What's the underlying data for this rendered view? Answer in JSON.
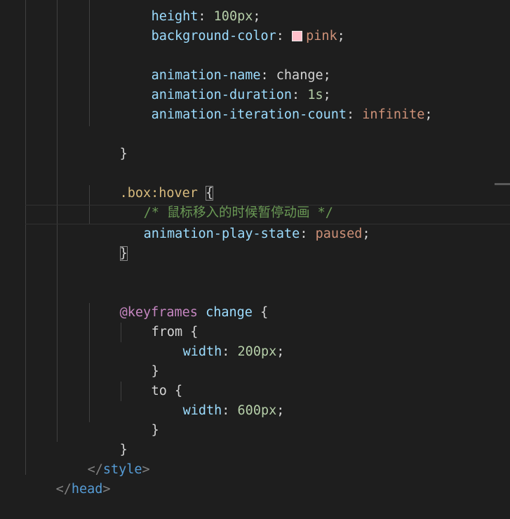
{
  "code": {
    "l0": {
      "prop": "height",
      "val": "100px"
    },
    "l1": {
      "prop": "background-color",
      "swatch": "#ffc0cb",
      "val": "pink"
    },
    "l3": {
      "prop": "animation-name",
      "val": "change"
    },
    "l4": {
      "prop": "animation-duration",
      "val": "1s"
    },
    "l5": {
      "prop": "animation-iteration-count",
      "val": "infinite"
    },
    "l7": {
      "brace": "}"
    },
    "l9": {
      "selector": ".box:hover",
      "brace": "{"
    },
    "l10": {
      "comment": "/* 鼠标移入的时候暂停动画 */"
    },
    "l11": {
      "prop": "animation-play-state",
      "val": "paused"
    },
    "l12": {
      "brace": "}"
    },
    "l15": {
      "at": "@keyframes",
      "name": "change",
      "brace": "{"
    },
    "l16": {
      "kw": "from",
      "brace": "{"
    },
    "l17": {
      "prop": "width",
      "val": "200px"
    },
    "l18": {
      "brace": "}"
    },
    "l19": {
      "kw": "to",
      "brace": "{"
    },
    "l20": {
      "prop": "width",
      "val": "600px"
    },
    "l21": {
      "brace": "}"
    },
    "l22": {
      "brace": "}"
    },
    "l23": {
      "open": "</",
      "tag": "style",
      "close": ">"
    },
    "l24": {
      "open": "</",
      "tag": "head",
      "close": ">"
    }
  },
  "colors": {
    "background": "#1e1e1e",
    "property": "#9cdcfe",
    "value": "#ce9178",
    "number": "#b5cea8",
    "selector": "#d7ba7d",
    "comment": "#6a9955",
    "at_rule": "#c586c0",
    "tag": "#569cd6"
  }
}
